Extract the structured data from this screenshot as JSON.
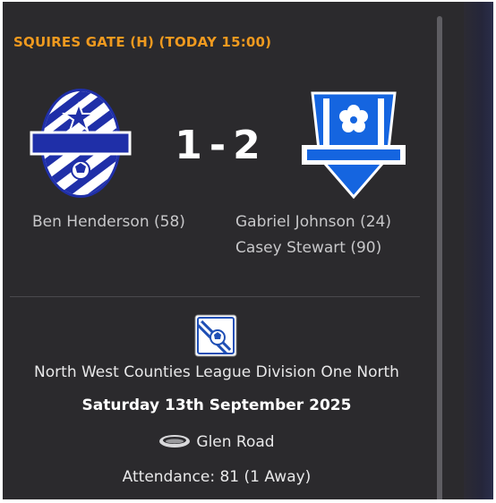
{
  "header": {
    "title": "SQUIRES GATE (H) (TODAY 15:00)"
  },
  "match": {
    "home_score": "1",
    "separator": "-",
    "away_score": "2",
    "home_scorers": [
      "Ben Henderson (58)"
    ],
    "away_scorers": [
      "Gabriel Johnson (24)",
      "Casey Stewart (90)"
    ]
  },
  "details": {
    "competition": "North West Counties League Division One North",
    "date": "Saturday 13th September 2025",
    "venue": "Glen Road",
    "attendance": "Attendance: 81 (1 Away)"
  },
  "icons": {
    "home_crest": "home-club-crest",
    "away_crest": "away-club-crest",
    "competition_logo": "competition-logo",
    "stadium": "stadium-icon"
  },
  "colors": {
    "panel_bg": "#2b2a2d",
    "header_accent": "#f09a1f",
    "home_crest_blue": "#1f2fa8",
    "away_crest_blue": "#1565e0"
  }
}
